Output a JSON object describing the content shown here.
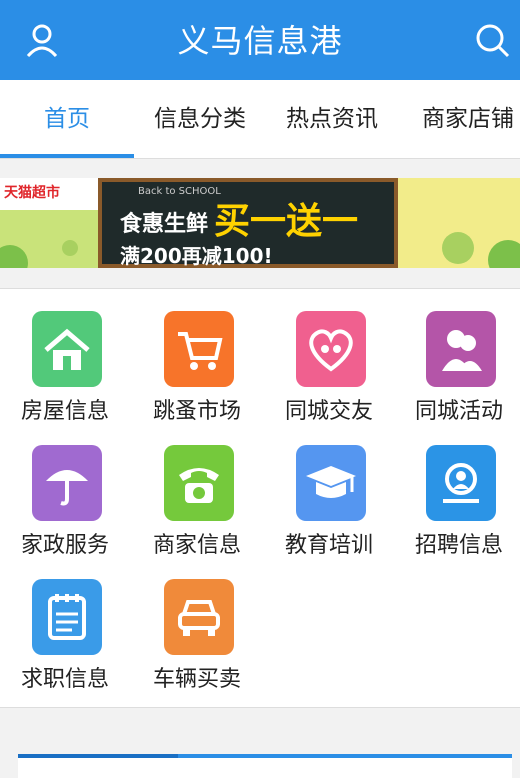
{
  "header": {
    "title": "义马信息港"
  },
  "tabs": [
    "首页",
    "信息分类",
    "热点资讯",
    "商家店铺"
  ],
  "banner": {
    "logo": "天猫超市",
    "line1": "食惠生鲜",
    "line2": "买一送一",
    "line3": "满200再减100!",
    "school": "Back to SCHOOL"
  },
  "categories": [
    {
      "label": "房屋信息",
      "color": "#52c97a",
      "icon": "house-icon"
    },
    {
      "label": "跳蚤市场",
      "color": "#f7742a",
      "icon": "cart-icon"
    },
    {
      "label": "同城交友",
      "color": "#f0608f",
      "icon": "heart-people-icon"
    },
    {
      "label": "同城活动",
      "color": "#b455a8",
      "icon": "people-icon"
    },
    {
      "label": "家政服务",
      "color": "#a06ad0",
      "icon": "umbrella-icon"
    },
    {
      "label": "商家信息",
      "color": "#75c93c",
      "icon": "phone-icon"
    },
    {
      "label": "教育培训",
      "color": "#5596f0",
      "icon": "graduation-cap-icon"
    },
    {
      "label": "招聘信息",
      "color": "#2b94e6",
      "icon": "magnifier-person-icon"
    },
    {
      "label": "求职信息",
      "color": "#3a9be8",
      "icon": "notepad-icon"
    },
    {
      "label": "车辆买卖",
      "color": "#f08a3a",
      "icon": "car-icon"
    }
  ]
}
